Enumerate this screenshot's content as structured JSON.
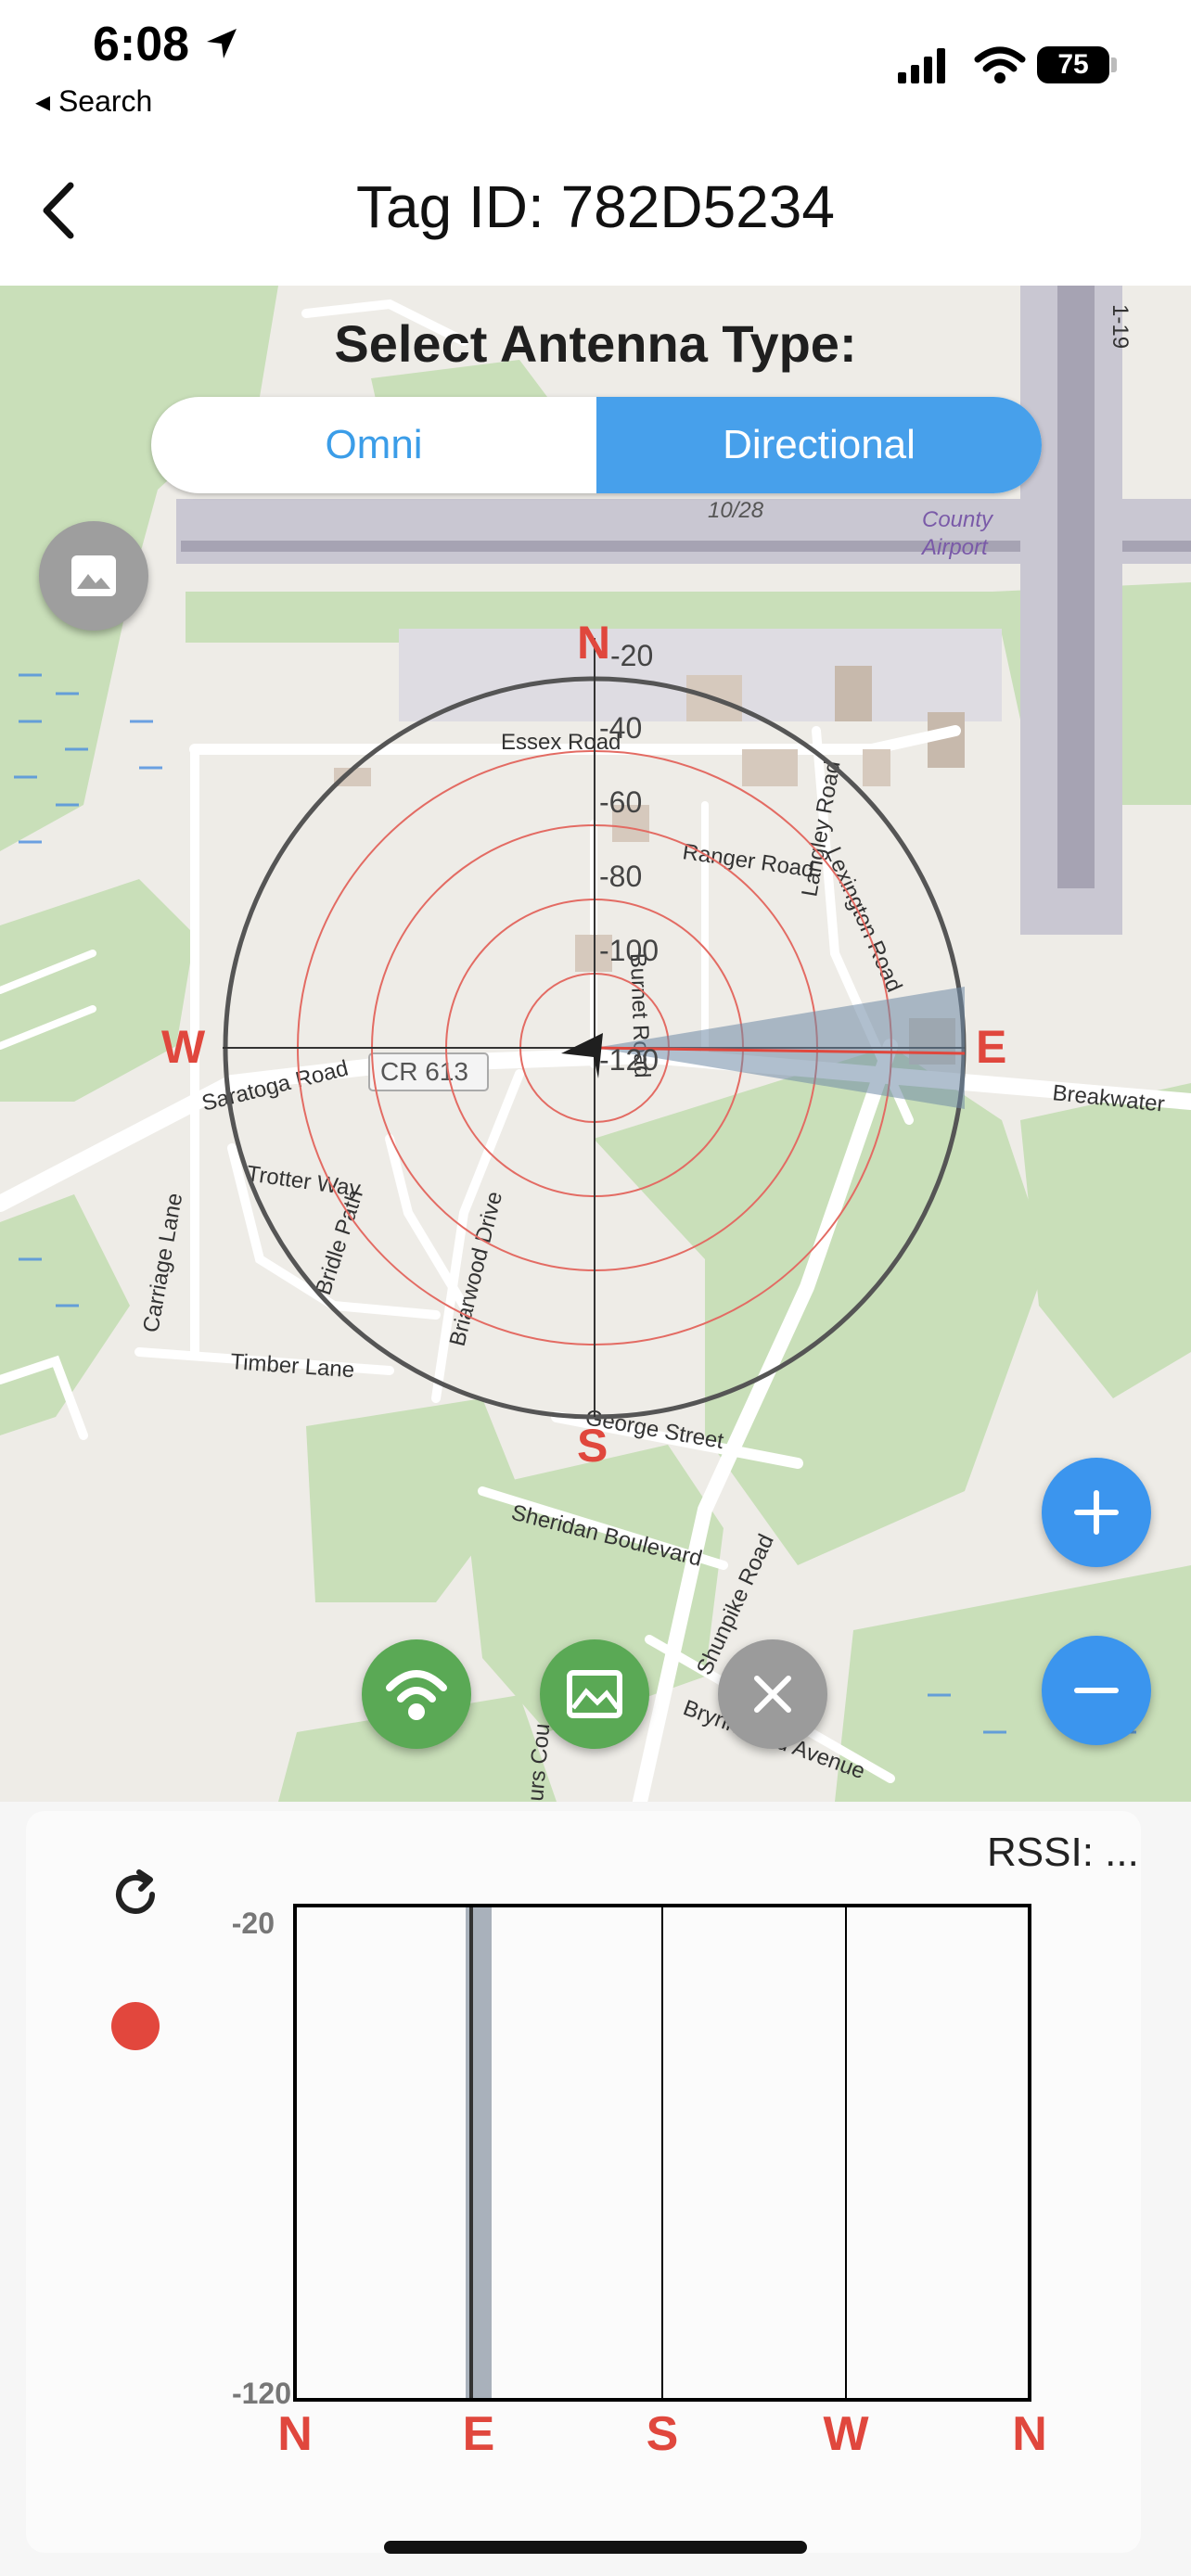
{
  "status_bar": {
    "time": "6:08",
    "back_app": "◂ Search",
    "battery": "75"
  },
  "nav": {
    "title": "Tag ID: 782D5234",
    "back_icon": "chevron-left-icon"
  },
  "antenna": {
    "label": "Select Antenna Type:",
    "options": [
      "Omni",
      "Directional"
    ],
    "selected": "Directional"
  },
  "map": {
    "labels": [
      "Essex Road",
      "Ranger Road",
      "Langley Road",
      "Lexington Road",
      "Saratoga Road",
      "CR 613",
      "Breakwater",
      "Trotter Way",
      "Bridle Path",
      "Briarwood Drive",
      "Carriage Lane",
      "Timber Lane",
      "George Street",
      "Sheridan Boulevard",
      "Shunpike Road",
      "Brynnwood Avenue",
      "10/28",
      "County",
      "Airport",
      "1-19",
      "urs Cou",
      "Burnet Road"
    ],
    "compass": {
      "north": "N",
      "east": "E",
      "south": "S",
      "west": "W",
      "ring_labels": [
        "-20",
        "-40",
        "-60",
        "-80",
        "-100",
        "-120"
      ]
    },
    "colors": {
      "compass_letters": "#e0473d",
      "rings": "#e36b63",
      "accent_blue": "#3b95ee",
      "green": "#5aa955"
    }
  },
  "controls": {
    "zoom_in": "plus-icon",
    "zoom_out": "minus-icon",
    "signal": "wifi-signal-icon",
    "terrain": "terrain-image-icon",
    "close": "close-icon"
  },
  "panel": {
    "rssi_label": "RSSI: ..."
  },
  "chart_data": {
    "type": "bar",
    "categories": [
      "N",
      "E",
      "S",
      "W",
      "N"
    ],
    "ylim": [
      -120,
      -20
    ],
    "ytick_labels": [
      "-20",
      "-120"
    ],
    "grid": true,
    "highlight_bearing": "E",
    "highlight_color": "#a9b1bb"
  }
}
